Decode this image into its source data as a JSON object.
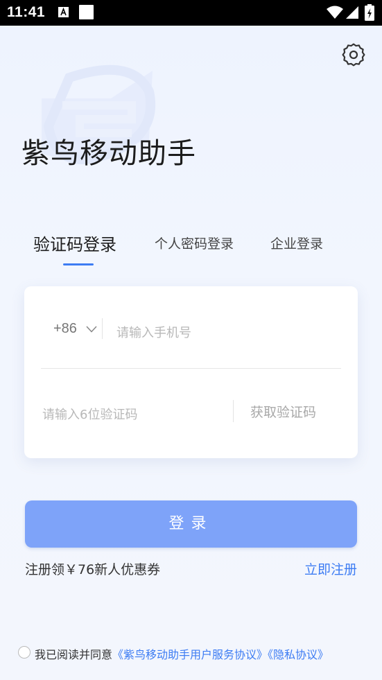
{
  "status_bar": {
    "time": "11:41",
    "icons": [
      "notification-a-icon",
      "notification-square-icon",
      "wifi-icon",
      "signal-icon",
      "battery-icon"
    ]
  },
  "header": {
    "settings_icon": "gear-icon",
    "app_title": "紫鸟移动助手"
  },
  "tabs": [
    {
      "label": "验证码登录",
      "active": true
    },
    {
      "label": "个人密码登录",
      "active": false
    },
    {
      "label": "企业登录",
      "active": false
    }
  ],
  "form": {
    "country_code": "+86",
    "phone_placeholder": "请输入手机号",
    "code_placeholder": "请输入6位验证码",
    "get_code_label": "获取验证码"
  },
  "login_button_label": "登录",
  "promo": {
    "text": "注册领￥76新人优惠券",
    "register_label": "立即注册"
  },
  "agreement": {
    "prefix": "我已阅读并同意",
    "terms_link": "《紫鸟移动助手用户服务协议》",
    "privacy_link": "《隐私协议》"
  },
  "colors": {
    "accent": "#3d7cf3",
    "button_bg": "#7ea3f9",
    "page_bg": "#eef3fd"
  }
}
